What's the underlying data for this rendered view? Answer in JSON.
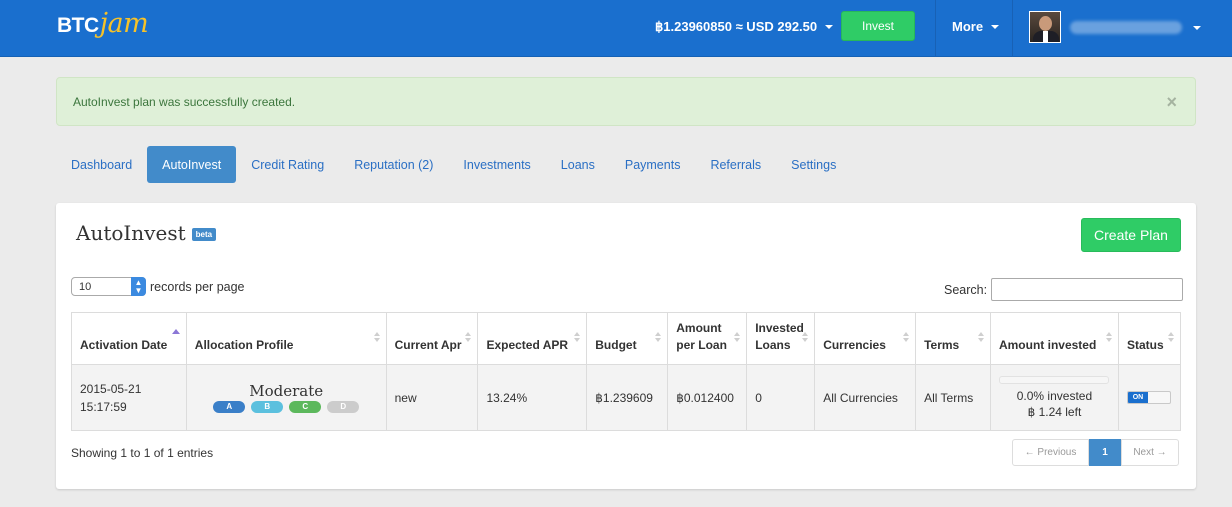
{
  "navbar": {
    "logo_btc": "BTC",
    "logo_jam": "jam",
    "balance": "฿1.23960850 ≈ USD 292.50",
    "invest_label": "Invest",
    "more_label": "More"
  },
  "alert": {
    "message": "AutoInvest plan was successfully created.",
    "close": "×"
  },
  "tabs": [
    {
      "label": "Dashboard"
    },
    {
      "label": "AutoInvest"
    },
    {
      "label": "Credit Rating"
    },
    {
      "label": "Reputation (2)"
    },
    {
      "label": "Investments"
    },
    {
      "label": "Loans"
    },
    {
      "label": "Payments"
    },
    {
      "label": "Referrals"
    },
    {
      "label": "Settings"
    }
  ],
  "panel": {
    "title": "AutoInvest",
    "beta": "beta",
    "create_label": "Create Plan",
    "records_value": "10",
    "records_label": "records per page",
    "search_label": "Search:"
  },
  "table": {
    "headers": [
      "Activation Date",
      "Allocation Profile",
      "Current Apr",
      "Expected APR",
      "Budget",
      "Amount per Loan",
      "Invested Loans",
      "Currencies",
      "Terms",
      "Amount invested",
      "Status"
    ],
    "row": {
      "date": "2015-05-21",
      "time": "15:17:59",
      "profile": "Moderate",
      "grades": [
        "A",
        "B",
        "C",
        "D"
      ],
      "current_apr": "new",
      "expected_apr": "13.24%",
      "budget": "฿1.239609",
      "amount_per_loan": "฿0.012400",
      "invested_loans": "0",
      "currencies": "All Currencies",
      "terms": "All Terms",
      "invested_pct": "0.0% invested",
      "left": "฿ 1.24 left",
      "invested_fraction": 0.0,
      "status": "ON"
    }
  },
  "footer": {
    "showing": "Showing 1 to 1 of 1 entries",
    "prev": "← Previous",
    "page": "1",
    "next": "Next →"
  },
  "colors": {
    "brand_blue": "#1a6fce",
    "green": "#2fcc66",
    "logo_yellow": "#f7c228",
    "grade_a": "#3a7fc8",
    "grade_b": "#5bc0de",
    "grade_c": "#5cb85c",
    "grade_d": "#cccccc"
  }
}
